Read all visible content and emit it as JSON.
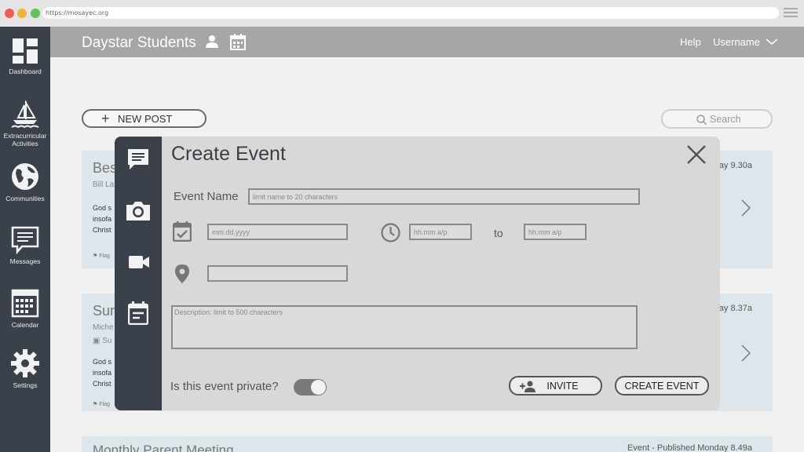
{
  "browser": {
    "url": "https://mosayec.org"
  },
  "sidebar": {
    "items": [
      {
        "label": "Dashboard"
      },
      {
        "label": "Extracurricular Activities"
      },
      {
        "label": "Communities"
      },
      {
        "label": "Messages"
      },
      {
        "label": "Calendar"
      },
      {
        "label": "Settings"
      }
    ]
  },
  "header": {
    "title": "Daystar Students",
    "help": "Help",
    "username": "Username"
  },
  "toolbar": {
    "new_post": "NEW POST",
    "search_placeholder": "Search"
  },
  "posts": [
    {
      "title": "Bes",
      "author": "Bill La",
      "body": [
        "God s",
        "insofa",
        "Christ"
      ],
      "flag": "Flag",
      "meta": "ay 9.30a"
    },
    {
      "title": "Sur",
      "author": "Miche",
      "date": "Su",
      "body": [
        "God s",
        "insofa",
        "Christ"
      ],
      "flag": "Flag",
      "meta": "ay 8.37a"
    },
    {
      "title": "Monthly Parent Meeting",
      "meta": "Event - Published Monday 8.49a"
    }
  ],
  "modal": {
    "title": "Create Event",
    "event_name_label": "Event Name",
    "event_name_placeholder": "limit name to 20 characters",
    "date_placeholder": "mm.dd.yyyy",
    "time_start_placeholder": "hh.mm a/p",
    "to_label": "to",
    "time_end_placeholder": "hh.mm a/p",
    "location_value": "",
    "description_placeholder": "Description: limit to 500 characters",
    "private_label": "Is this event private?",
    "private_on": true,
    "invite_label": "INVITE",
    "create_label": "CREATE EVENT"
  }
}
